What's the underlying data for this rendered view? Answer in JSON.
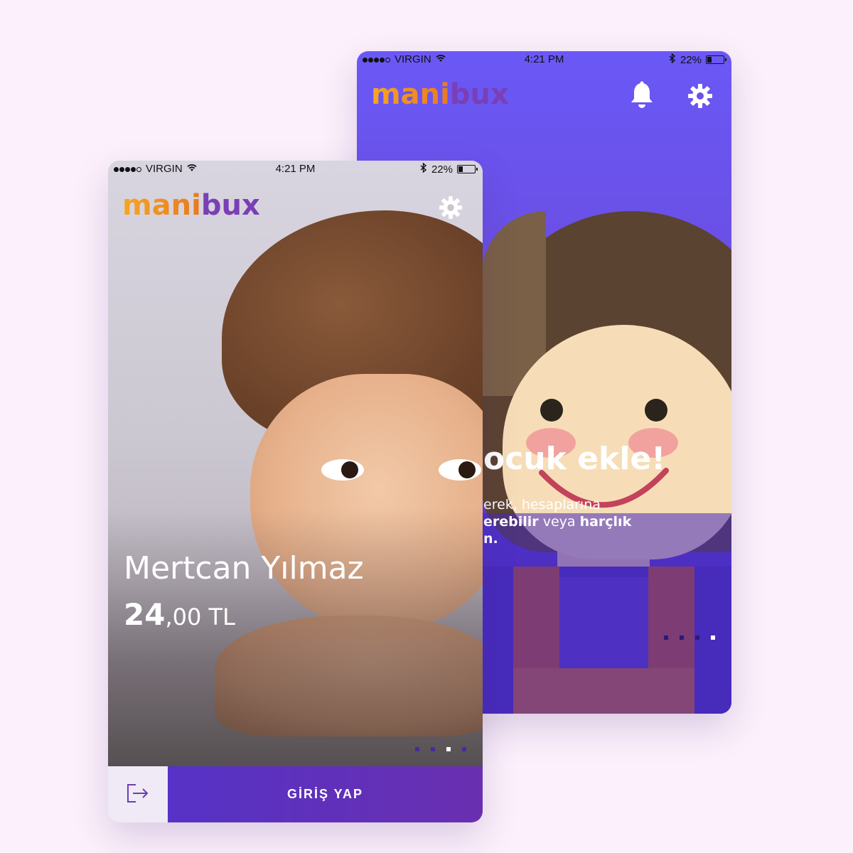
{
  "status_bar": {
    "carrier": "VIRGIN",
    "time": "4:21 PM",
    "battery": "22%"
  },
  "brand": {
    "name_part1": "mani",
    "name_part2": "bux"
  },
  "back_screen": {
    "headline": "ocuk ekle!",
    "line1": "erek, hesaplarına",
    "line2_bold": "erebilir",
    "line2_mid": " veya ",
    "line2_bold2": "harçlık",
    "line3": "n."
  },
  "front_screen": {
    "child_name": "Mertcan Yılmaz",
    "balance_whole": "24",
    "balance_fraction": ",00 TL",
    "login_label": "GİRİŞ YAP"
  },
  "colors": {
    "page_bg": "#fbf0fb",
    "primary_purple": "#5a3bd0",
    "brand_orange": "#f5a623",
    "brand_purple": "#7a3fb5"
  },
  "icons": {
    "bell": "bell-icon",
    "settings": "gear-icon",
    "logout": "logout-icon",
    "wifi": "wifi-icon",
    "bluetooth": "bluetooth-icon"
  },
  "pagination": {
    "back_active_index": 3,
    "front_active_index": 2
  }
}
